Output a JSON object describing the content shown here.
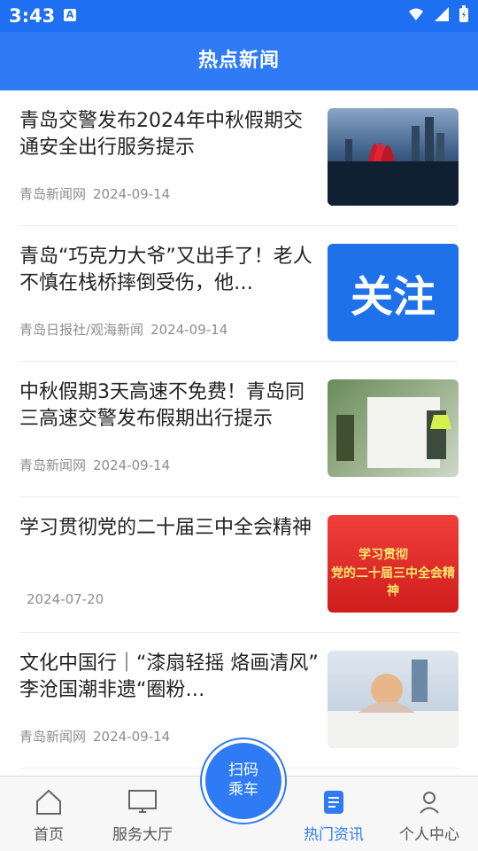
{
  "status": {
    "time": "3:43"
  },
  "header": {
    "title": "热点新闻"
  },
  "news": [
    {
      "title": "青岛交警发布2024年中秋假期交通安全出行服务提示",
      "source": "青岛新闻网",
      "date": "2024-09-14"
    },
    {
      "title": "青岛“巧克力大爷”又出手了！老人不慎在栈桥摔倒受伤，他…",
      "source": "青岛日报社/观海新闻",
      "date": "2024-09-14",
      "thumb_text": "关注"
    },
    {
      "title": "中秋假期3天高速不免费！青岛同三高速交警发布假期出行提示",
      "source": "青岛新闻网",
      "date": "2024-09-14"
    },
    {
      "title": "学习贯彻党的二十届三中全会精神",
      "source": "",
      "date": "2024-07-20",
      "thumb_line1": "学习贯彻",
      "thumb_line2": "党的二十届三中全会精神"
    },
    {
      "title": "文化中国行｜“漆扇轻摇 烙画清风” 李沧国潮非遗“圈粉…",
      "source": "青岛新闻网",
      "date": "2024-09-14"
    }
  ],
  "nav": {
    "home": "首页",
    "service": "服务大厅",
    "scan1": "扫码",
    "scan2": "乘车",
    "hot": "热门资讯",
    "profile": "个人中心"
  }
}
